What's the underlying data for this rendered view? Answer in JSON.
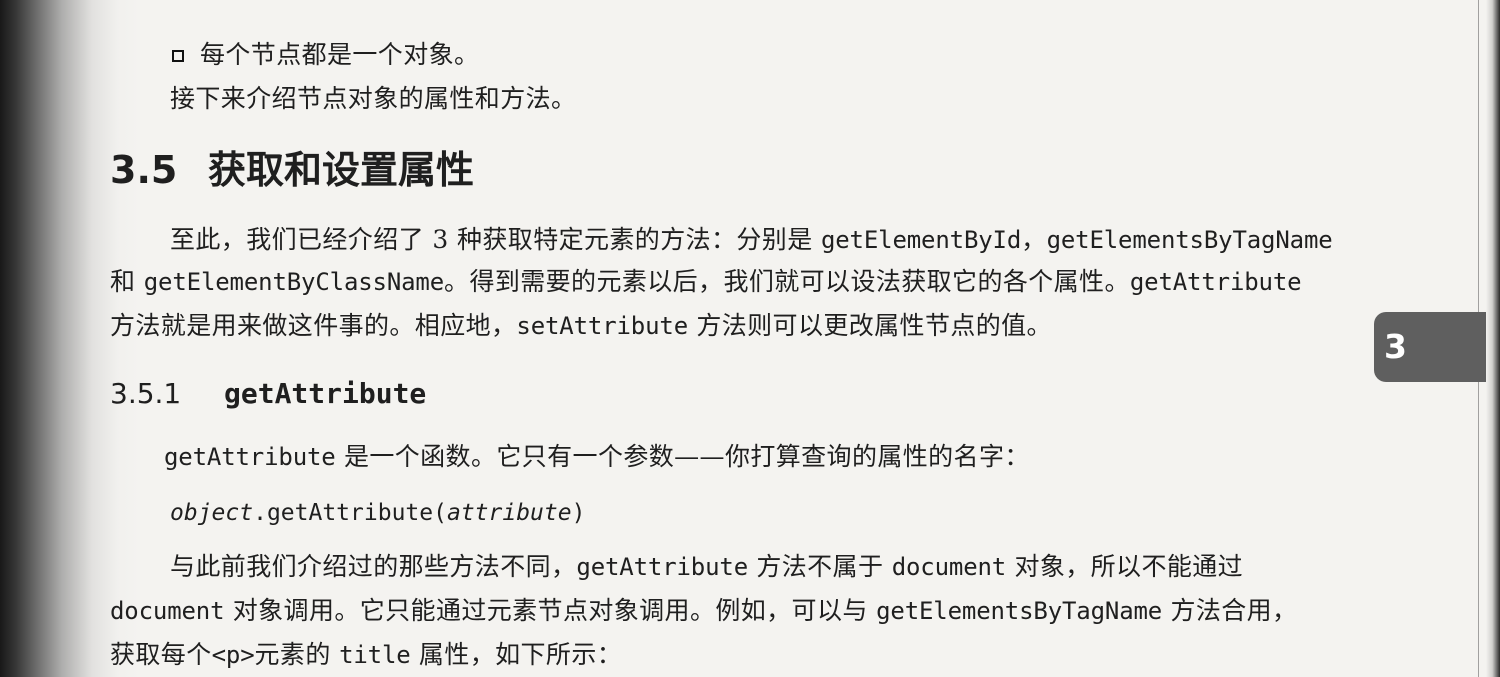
{
  "bullet_item": "每个节点都是一个对象。",
  "intro_line": "接下来介绍节点对象的属性和方法。",
  "section": {
    "number": "3.5",
    "title": "获取和设置属性"
  },
  "paragraph1": {
    "line1_prefix": "至此，我们已经介绍了 3 种获取特定元素的方法：分别是 ",
    "line1_code1": "getElementById",
    "line1_comma": "，",
    "line1_code2": "getElementsByTagName",
    "line2_prefix": "和 ",
    "line2_code1": "getElementByClassName",
    "line2_middle": "。得到需要的元素以后，我们就可以设法获取它的各个属性。",
    "line2_code2": "getAttribute",
    "line3_prefix": "方法就是用来做这件事的。相应地，",
    "line3_code": "setAttribute",
    "line3_suffix": " 方法则可以更改属性节点的值。"
  },
  "subsection": {
    "number": "3.5.1",
    "title": "getAttribute"
  },
  "paragraph2": {
    "code": "getAttribute",
    "text": " 是一个函数。它只有一个参数——你打算查询的属性的名字："
  },
  "code_example": {
    "object": "object",
    "method": ".getAttribute(",
    "argument": "attribute",
    "close": ")"
  },
  "paragraph3": {
    "line1_prefix": "与此前我们介绍过的那些方法不同，",
    "line1_code1": "getAttribute",
    "line1_middle": " 方法不属于 ",
    "line1_code2": "document",
    "line1_suffix": " 对象，所以不能通过",
    "line2_code1": "document",
    "line2_middle": " 对象调用。它只能通过元素节点对象调用。例如，可以与 ",
    "line2_code2": "getElementsByTagName",
    "line2_suffix": " 方法合用，",
    "line3_prefix": "获取每个",
    "line3_tag": "<p>",
    "line3_middle": "元素的 ",
    "line3_code": "title",
    "line3_suffix": " 属性，如下所示："
  },
  "chapter_tab": "3"
}
